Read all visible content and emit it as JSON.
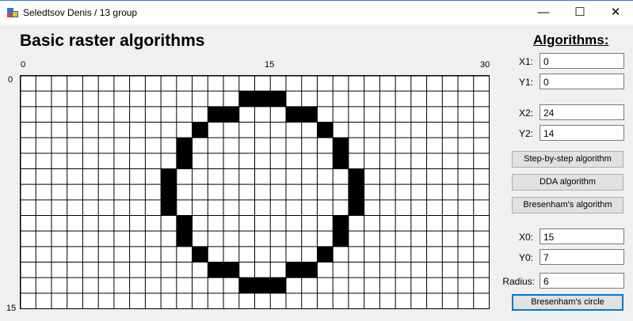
{
  "window": {
    "title": "Seledtsov Denis / 13 group",
    "minimize": "—",
    "maximize": "☐",
    "close": "✕"
  },
  "canvas": {
    "heading": "Basic raster algorithms",
    "x_ticks": [
      "0",
      "15",
      "30"
    ],
    "y_ticks": [
      "0",
      "15"
    ],
    "columns": 30,
    "rows": 15,
    "filled_cells": [
      [
        14,
        1
      ],
      [
        15,
        1
      ],
      [
        16,
        1
      ],
      [
        12,
        2
      ],
      [
        13,
        2
      ],
      [
        17,
        2
      ],
      [
        18,
        2
      ],
      [
        11,
        3
      ],
      [
        19,
        3
      ],
      [
        10,
        4
      ],
      [
        20,
        4
      ],
      [
        10,
        5
      ],
      [
        20,
        5
      ],
      [
        9,
        6
      ],
      [
        21,
        6
      ],
      [
        9,
        7
      ],
      [
        21,
        7
      ],
      [
        9,
        8
      ],
      [
        21,
        8
      ],
      [
        10,
        9
      ],
      [
        20,
        9
      ],
      [
        10,
        10
      ],
      [
        20,
        10
      ],
      [
        11,
        11
      ],
      [
        19,
        11
      ],
      [
        12,
        12
      ],
      [
        13,
        12
      ],
      [
        17,
        12
      ],
      [
        18,
        12
      ],
      [
        14,
        13
      ],
      [
        15,
        13
      ],
      [
        16,
        13
      ]
    ],
    "cell_fill_color": "#000000",
    "grid_line_color": "#000000"
  },
  "panel": {
    "title": "Algorithms:",
    "x1_label": "X1:",
    "x1_value": "0",
    "y1_label": "Y1:",
    "y1_value": "0",
    "x2_label": "X2:",
    "x2_value": "24",
    "y2_label": "Y2:",
    "y2_value": "14",
    "step_button": "Step-by-step algorithm",
    "dda_button": "DDA algorithm",
    "bresenham_button": "Bresenham's algorithm",
    "x0_label": "X0:",
    "x0_value": "15",
    "y0_label": "Y0:",
    "y0_value": "7",
    "radius_label": "Radius:",
    "radius_value": "6",
    "circle_button": "Bresenham's circle"
  }
}
